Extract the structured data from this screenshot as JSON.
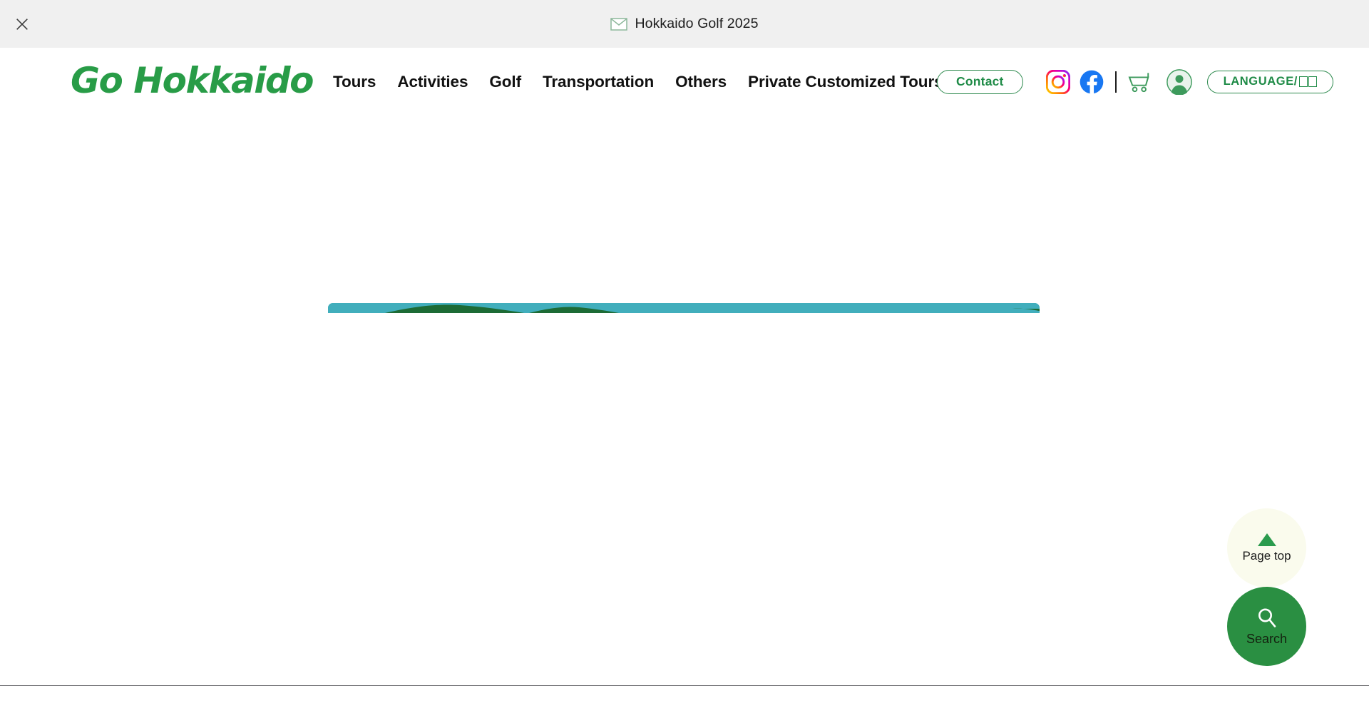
{
  "window": {
    "close_label": "close",
    "close_icon": "close-icon"
  },
  "topbar": {
    "icon": "mail-envelope-icon",
    "title": "Hokkaido Golf 2025"
  },
  "header": {
    "logo": {
      "icon": "go-logo-icon",
      "text": "Go Hokkaido",
      "word_1": "Go",
      "word_2": "Hokkaido",
      "color": "#289c47"
    },
    "nav": [
      {
        "label": "Tours",
        "name": "nav-item-tours"
      },
      {
        "label": "Activities",
        "name": "nav-item-activities"
      },
      {
        "label": "Golf",
        "name": "nav-item-golf"
      },
      {
        "label": "Transportation",
        "name": "nav-item-transportation"
      },
      {
        "label": "Others",
        "name": "nav-item-others"
      },
      {
        "label": "Private Customized Tours",
        "name": "nav-item-private-customized-tours"
      }
    ],
    "contact_label": "Contact",
    "instagram_icon": "instagram-icon",
    "facebook_icon": "facebook-icon",
    "cart_icon": "shopping-cart-icon",
    "account_icon": "user-account-icon",
    "language_label": "LANGUAGE/",
    "language_suffix_glyphs": 2,
    "accent_color": "#1f8b47"
  },
  "main": {
    "card_banner_color": "#41aebc",
    "card_banner_accent_color": "#1d6b35",
    "state": "loading"
  },
  "fabs": {
    "page_top": {
      "label": "Page top",
      "icon": "triangle-up-icon",
      "background": "#fafbed"
    },
    "search": {
      "label": "Search",
      "icon": "search-icon",
      "background": "#2a8f42"
    }
  }
}
